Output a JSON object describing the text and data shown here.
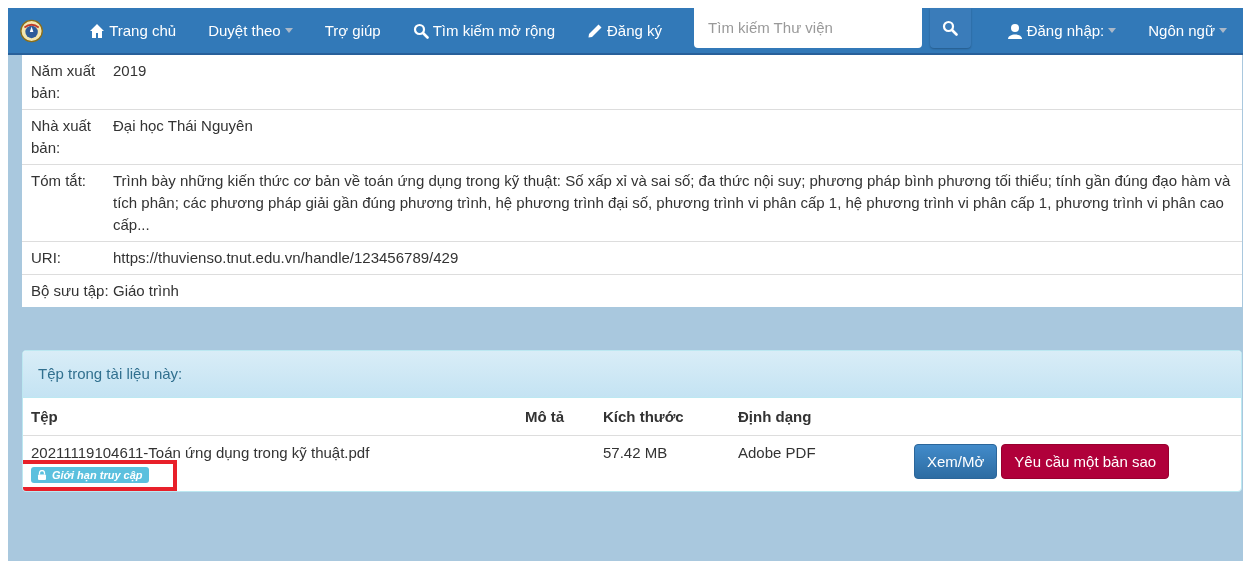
{
  "navbar": {
    "items": [
      {
        "label": "Trang chủ",
        "dropdown": false
      },
      {
        "label": "Duyệt theo",
        "dropdown": true
      },
      {
        "label": "Trợ giúp",
        "dropdown": false
      },
      {
        "label": "Tìm kiếm mở rộng",
        "dropdown": false
      },
      {
        "label": "Đăng ký",
        "dropdown": false
      }
    ],
    "search": {
      "placeholder": "Tìm kiếm Thư viện"
    },
    "right_items": [
      {
        "label": "Đăng nhập:",
        "dropdown": true
      },
      {
        "label": "Ngôn ngữ",
        "dropdown": true
      }
    ]
  },
  "metadata": [
    {
      "label": "Năm xuất bản:",
      "value": "2019"
    },
    {
      "label": "Nhà xuất bản:",
      "value": "Đại học Thái Nguyên"
    },
    {
      "label": "Tóm tắt:",
      "value": "Trình bày những kiến thức cơ bản về toán ứng dụng trong kỹ thuật: Số xấp xỉ và sai số; đa thức nội suy; phương pháp bình phương tối thiểu; tính gần đúng đạo hàm và tích phân; các phương pháp giải gần đúng phương trình, hệ phương trình đại số, phương trình vi phân cấp 1, hệ phương trình vi phân cấp 1, phương trình vi phân cao cấp..."
    },
    {
      "label": "URI:",
      "value": "https://thuvienso.tnut.edu.vn/handle/123456789/429"
    },
    {
      "label": "Bộ sưu tập:",
      "value": "Giáo trình"
    }
  ],
  "files": {
    "title": "Tệp trong tài liệu này:",
    "columns": [
      "Tệp",
      "Mô tả",
      "Kích thước",
      "Định dạng"
    ],
    "rows": [
      {
        "name": "20211119104611-Toán ứng dụng trong kỹ thuật.pdf",
        "badge": "Giới hạn truy cập",
        "highlighted": true,
        "size": "57.42 MB",
        "format": "Adobe PDF",
        "buttons": [
          {
            "label": "Xem/Mở",
            "kind": "primary"
          },
          {
            "label": "Yêu cầu một bản sao",
            "kind": "danger"
          }
        ]
      }
    ]
  }
}
